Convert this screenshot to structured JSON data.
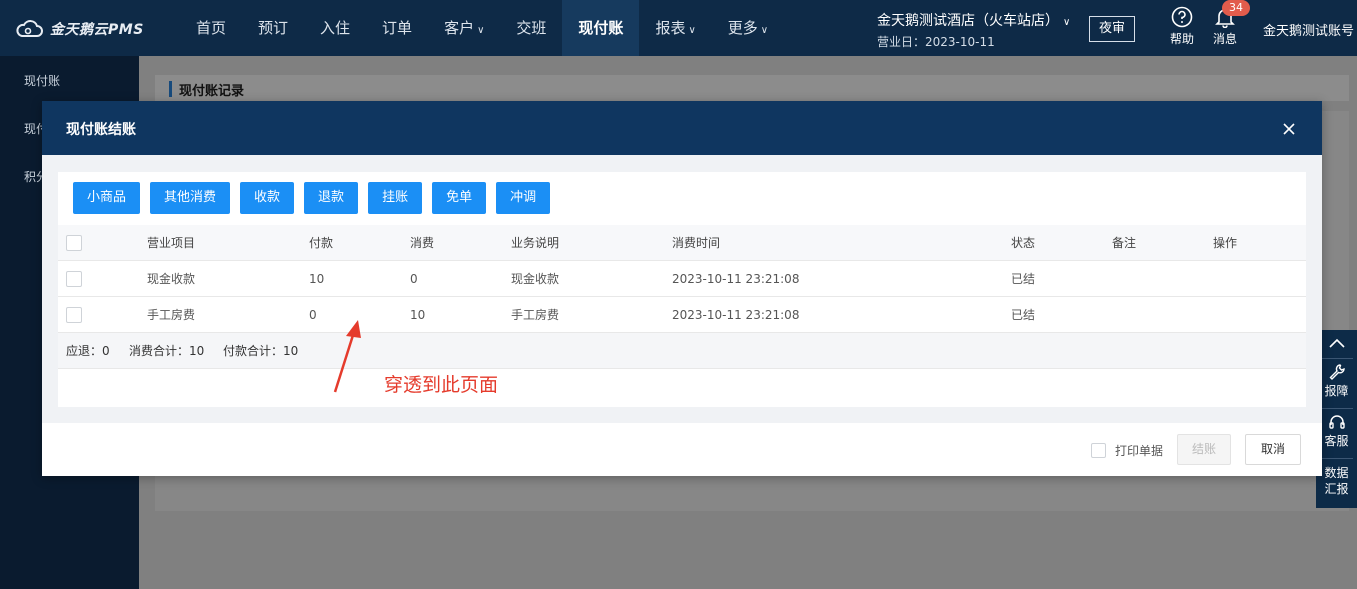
{
  "app": {
    "logo_text": "金天鹅云PMS"
  },
  "nav": {
    "items": [
      {
        "label": "首页",
        "has_dropdown": false
      },
      {
        "label": "预订",
        "has_dropdown": false
      },
      {
        "label": "入住",
        "has_dropdown": false
      },
      {
        "label": "订单",
        "has_dropdown": false
      },
      {
        "label": "客户",
        "has_dropdown": true
      },
      {
        "label": "交班",
        "has_dropdown": false
      },
      {
        "label": "现付账",
        "has_dropdown": false,
        "active": true
      },
      {
        "label": "报表",
        "has_dropdown": true
      },
      {
        "label": "更多",
        "has_dropdown": true
      }
    ],
    "dropdown_glyph": "∨"
  },
  "header": {
    "hotel_name": "金天鹅测试酒店（火车站店）",
    "business_date": "营业日：2023-10-11",
    "night_audit": "夜审",
    "help": "帮助",
    "messages": "消息",
    "message_count": "34",
    "account": "金天鹅测试账号"
  },
  "sidebar": {
    "items": [
      "现付账",
      "现付",
      "积分"
    ]
  },
  "background": {
    "panel_title": "现付账记录"
  },
  "right_tools": {
    "items": [
      "报障",
      "客服",
      "数据汇报"
    ]
  },
  "modal": {
    "title": "现付账结账",
    "buttons": [
      "小商品",
      "其他消费",
      "收款",
      "退款",
      "挂账",
      "免单",
      "冲调"
    ],
    "table": {
      "columns": [
        "营业项目",
        "付款",
        "消费",
        "业务说明",
        "消费时间",
        "状态",
        "备注",
        "操作"
      ],
      "rows": [
        [
          "现金收款",
          "10",
          "0",
          "现金收款",
          "2023-10-11 23:21:08",
          "已结",
          "",
          ""
        ],
        [
          "手工房费",
          "0",
          "10",
          "手工房费",
          "2023-10-11 23:21:08",
          "已结",
          "",
          ""
        ]
      ]
    },
    "summary": {
      "refund": "应退：0",
      "consume_total": "消费合计：10",
      "pay_total": "付款合计：10"
    },
    "footer": {
      "print_label": "打印单据",
      "settle": "结账",
      "cancel": "取消"
    }
  },
  "annotation": {
    "text": "穿透到此页面",
    "color": "#e53b2c"
  },
  "colors": {
    "nav_bg": "#0e2a47",
    "modal_header": "#0f3660",
    "primary_button": "#1b8ff5"
  }
}
